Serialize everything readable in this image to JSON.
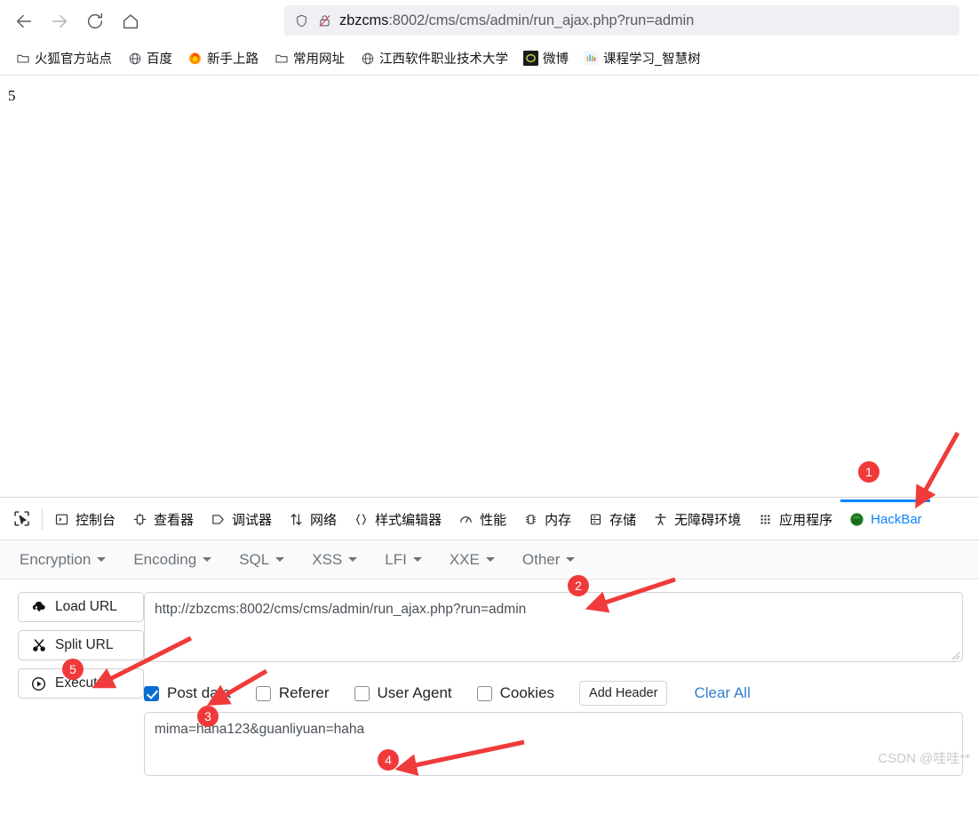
{
  "browser": {
    "nav": {
      "back_label": "back-arrow",
      "forward_label": "forward-arrow",
      "reload_label": "reload",
      "home_label": "home"
    },
    "urlbar": {
      "shield_icon": "shield-icon",
      "lock_icon": "lock-crossed-icon",
      "url_host": "zbzcms",
      "url_rest": ":8002/cms/cms/admin/run_ajax.php?run=admin",
      "full_url": "zbzcms:8002/cms/cms/admin/run_ajax.php?run=admin"
    },
    "bookmarks": [
      {
        "label": "火狐官方站点",
        "icon": "folder-icon"
      },
      {
        "label": "百度",
        "icon": "globe-icon"
      },
      {
        "label": "新手上路",
        "icon": "firefox-icon"
      },
      {
        "label": "常用网址",
        "icon": "folder-icon"
      },
      {
        "label": "江西软件职业技术大学",
        "icon": "globe-icon"
      },
      {
        "label": "微博",
        "icon": "weibo-icon"
      },
      {
        "label": "课程学习_智慧树",
        "icon": "zhihuishu-icon"
      }
    ]
  },
  "page": {
    "body_text": "5"
  },
  "devtools": {
    "picker_icon": "element-picker-icon",
    "tabs": [
      {
        "label": "控制台",
        "icon": "console-icon",
        "active": false
      },
      {
        "label": "查看器",
        "icon": "inspector-icon",
        "active": false
      },
      {
        "label": "调试器",
        "icon": "debugger-icon",
        "active": false
      },
      {
        "label": "网络",
        "icon": "network-icon",
        "active": false
      },
      {
        "label": "样式编辑器",
        "icon": "style-editor-icon",
        "active": false
      },
      {
        "label": "性能",
        "icon": "performance-icon",
        "active": false
      },
      {
        "label": "内存",
        "icon": "memory-icon",
        "active": false
      },
      {
        "label": "存储",
        "icon": "storage-icon",
        "active": false
      },
      {
        "label": "无障碍环境",
        "icon": "accessibility-icon",
        "active": false
      },
      {
        "label": "应用程序",
        "icon": "application-icon",
        "active": false
      },
      {
        "label": "HackBar",
        "icon": "hackbar-icon",
        "active": true
      }
    ],
    "active_tab_color": "#0a84ff"
  },
  "hackbar": {
    "menus": [
      {
        "label": "Encryption"
      },
      {
        "label": "Encoding"
      },
      {
        "label": "SQL"
      },
      {
        "label": "XSS"
      },
      {
        "label": "LFI"
      },
      {
        "label": "XXE"
      },
      {
        "label": "Other"
      }
    ],
    "side_buttons": [
      {
        "label": "Load URL",
        "icon": "cloud-download-icon"
      },
      {
        "label": "Split URL",
        "icon": "scissors-icon"
      },
      {
        "label": "Execute",
        "icon": "play-circle-icon"
      }
    ],
    "url_field": {
      "value": "http://zbzcms:8002/cms/cms/admin/run_ajax.php?run=admin",
      "placeholder": ""
    },
    "options": [
      {
        "label": "Post data",
        "checked": true
      },
      {
        "label": "Referer",
        "checked": false
      },
      {
        "label": "User Agent",
        "checked": false
      },
      {
        "label": "Cookies",
        "checked": false
      }
    ],
    "add_header_label": "Add Header",
    "clear_all_label": "Clear All",
    "post_field": {
      "value": "mima=haha123&guanliyuan=haha",
      "placeholder": ""
    }
  },
  "watermark": {
    "text": "CSDN @哇哇**"
  },
  "annotations": {
    "badge_color": "#f03a3a",
    "arrow_color": "#ef3b3b",
    "badges": [
      {
        "id": "1",
        "label": "1"
      },
      {
        "id": "2",
        "label": "2"
      },
      {
        "id": "3",
        "label": "3"
      },
      {
        "id": "4",
        "label": "4"
      },
      {
        "id": "5",
        "label": "5"
      }
    ]
  }
}
